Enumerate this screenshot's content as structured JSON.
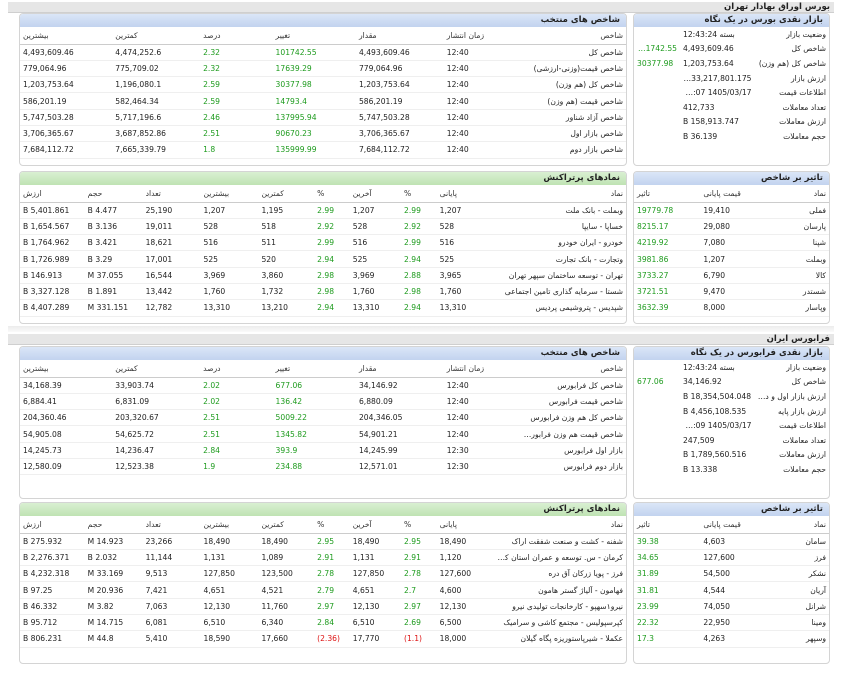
{
  "tehran": {
    "title": "بورس اوراق بهادار تهران",
    "market": {
      "header": "بازار نقدی بورس در یک نگاه",
      "rows": [
        {
          "k": "وضعیت بازار",
          "v": "بسته 12:43:24",
          "c": ""
        },
        {
          "k": "شاخص کل",
          "v": "4,493,609.46",
          "c": "101742.55"
        },
        {
          "k": "شاخص کل (هم وزن)",
          "v": "1,203,753.64",
          "c": "30377.98"
        },
        {
          "k": "ارزش بازار",
          "v": "133,217,801.175 B",
          "c": ""
        },
        {
          "k": "اطلاعات قیمت",
          "v": "1405/03/17 12:43:07",
          "c": ""
        },
        {
          "k": "تعداد معاملات",
          "v": "412,733",
          "c": ""
        },
        {
          "k": "ارزش معاملات",
          "v": "158,913.747 B",
          "c": ""
        },
        {
          "k": "حجم معاملات",
          "v": "36.139 B",
          "c": ""
        }
      ]
    },
    "indices": {
      "header": "شاخص های منتخب",
      "cols": [
        "شاخص",
        "زمان انتشار",
        "مقدار",
        "تغییر",
        "درصد",
        "کمترین",
        "بیشترین"
      ],
      "rows": [
        [
          "شاخص کل",
          "12:40",
          "4,493,609.46",
          "101742.55",
          "2.32",
          "4,474,252.6",
          "4,493,609.46"
        ],
        [
          "شاخص قیمت(وزنی-ارزشی)",
          "12:40",
          "779,064.96",
          "17639.29",
          "2.32",
          "775,709.02",
          "779,064.96"
        ],
        [
          "شاخص کل (هم وزن)",
          "12:40",
          "1,203,753.64",
          "30377.98",
          "2.59",
          "1,196,080.1",
          "1,203,753.64"
        ],
        [
          "شاخص قیمت (هم وزن)",
          "12:40",
          "586,201.19",
          "14793.4",
          "2.59",
          "582,464.34",
          "586,201.19"
        ],
        [
          "شاخص آزاد شناور",
          "12:40",
          "5,747,503.28",
          "137995.94",
          "2.46",
          "5,717,196.6",
          "5,747,503.28"
        ],
        [
          "شاخص بازار اول",
          "12:40",
          "3,706,365.67",
          "90670.23",
          "2.51",
          "3,687,852.86",
          "3,706,365.67"
        ],
        [
          "شاخص بازار دوم",
          "12:40",
          "7,684,112.72",
          "135999.99",
          "1.8",
          "7,665,339.79",
          "7,684,112.72"
        ]
      ]
    },
    "impact": {
      "header": "تاثیر بر شاخص",
      "cols": [
        "نماد",
        "قیمت پایانی",
        "تاثیر"
      ],
      "rows": [
        [
          "فملی",
          "19,410",
          "19779.78"
        ],
        [
          "پارسان",
          "29,080",
          "8215.17"
        ],
        [
          "شپنا",
          "7,080",
          "4219.92"
        ],
        [
          "وبملت",
          "1,207",
          "3981.86"
        ],
        [
          "کالا",
          "6,790",
          "3733.27"
        ],
        [
          "شستدر",
          "9,470",
          "3721.51"
        ],
        [
          "وپاسار",
          "8,000",
          "3632.39"
        ]
      ]
    },
    "symbols": {
      "header": "نمادهای پرتراکنش",
      "cols": [
        "نماد",
        "پایانی",
        "%",
        "آخرین",
        "%",
        "کمترین",
        "بیشترین",
        "تعداد",
        "حجم",
        "ارزش"
      ],
      "rows": [
        [
          "وبملت - بانک ملت",
          "1,207",
          "2.99",
          "1,207",
          "2.99",
          "1,195",
          "1,207",
          "25,190",
          "4.477 B",
          "5,401.861 B"
        ],
        [
          "خساپا - سایپا",
          "528",
          "2.92",
          "528",
          "2.92",
          "518",
          "528",
          "19,011",
          "3.136 B",
          "1,654.567 B"
        ],
        [
          "خودرو - ایران خودرو",
          "516",
          "2.99",
          "516",
          "2.99",
          "511",
          "516",
          "18,621",
          "3.421 B",
          "1,764.962 B"
        ],
        [
          "وتجارت - بانک تجارت",
          "525",
          "2.94",
          "525",
          "2.94",
          "520",
          "525",
          "17,001",
          "3.29 B",
          "1,726.989 B"
        ],
        [
          "تهران - توسعه ساختمان سپهر تهران",
          "3,965",
          "2.88",
          "3,969",
          "2.98",
          "3,860",
          "3,969",
          "16,544",
          "37.055 M",
          "146.913 B"
        ],
        [
          "شستا - سرمایه گذاری تامین اجتماعی",
          "1,760",
          "2.98",
          "1,760",
          "2.98",
          "1,732",
          "1,760",
          "13,442",
          "1.891 B",
          "3,327.128 B"
        ],
        [
          "شپدیس - پتروشیمی پردیس",
          "13,310",
          "2.94",
          "13,310",
          "2.94",
          "13,210",
          "13,310",
          "12,782",
          "331.151 M",
          "4,407.289 B"
        ]
      ]
    }
  },
  "farabourse": {
    "title": "فرابورس ایران",
    "market": {
      "header": "بازار نقدی فرابورس در یک نگاه",
      "rows": [
        {
          "k": "وضعیت بازار",
          "v": "بسته 12:43:24",
          "c": ""
        },
        {
          "k": "شاخص کل",
          "v": "34,146.92",
          "c": "677.06"
        },
        {
          "k": "ارزش بازار اول و دوم",
          "v": "18,354,504.048 B",
          "c": ""
        },
        {
          "k": "ارزش بازار پایه",
          "v": "4,456,108.535 B",
          "c": ""
        },
        {
          "k": "اطلاعات قیمت",
          "v": "1405/03/17 12:43:09",
          "c": ""
        },
        {
          "k": "تعداد معاملات",
          "v": "247,509",
          "c": ""
        },
        {
          "k": "ارزش معاملات",
          "v": "1,789,560.516 B",
          "c": ""
        },
        {
          "k": "حجم معاملات",
          "v": "13.338 B",
          "c": ""
        }
      ]
    },
    "indices": {
      "header": "شاخص های منتخب",
      "cols": [
        "شاخص",
        "زمان انتشار",
        "مقدار",
        "تغییر",
        "درصد",
        "کمترین",
        "بیشترین"
      ],
      "rows": [
        [
          "شاخص کل فرابورس",
          "12:40",
          "34,146.92",
          "677.06",
          "2.02",
          "33,903.74",
          "34,168.39"
        ],
        [
          "شاخص قیمت فرابورس",
          "12:40",
          "6,880.09",
          "136.42",
          "2.02",
          "6,831.09",
          "6,884.41"
        ],
        [
          "شاخص کل هم وزن فرابورس",
          "12:40",
          "204,346.05",
          "5009.22",
          "2.51",
          "203,320.67",
          "204,360.46"
        ],
        [
          "شاخص قیمت هم وزن فرابورس",
          "12:40",
          "54,901.21",
          "1345.82",
          "2.51",
          "54,625.72",
          "54,905.08"
        ],
        [
          "بازار اول فرابورس",
          "12:30",
          "14,245.99",
          "393.9",
          "2.84",
          "14,236.47",
          "14,245.73"
        ],
        [
          "بازار دوم فرابورس",
          "12:30",
          "12,571.01",
          "234.88",
          "1.9",
          "12,523.38",
          "12,580.09"
        ]
      ]
    },
    "impact": {
      "header": "تاثیر بر شاخص",
      "cols": [
        "نماد",
        "قیمت پایانی",
        "تاثیر"
      ],
      "rows": [
        [
          "سامان",
          "4,603",
          "39.38"
        ],
        [
          "فرز",
          "127,600",
          "34.65"
        ],
        [
          "نشکر",
          "54,500",
          "31.89"
        ],
        [
          "آریان",
          "4,544",
          "31.81"
        ],
        [
          "شرانل",
          "74,050",
          "23.99"
        ],
        [
          "ومینا",
          "22,950",
          "22.32"
        ],
        [
          "وسپهر",
          "4,263",
          "17.3"
        ]
      ]
    },
    "symbols": {
      "header": "نمادهای پرتراکنش",
      "cols": [
        "نماد",
        "پایانی",
        "%",
        "آخرین",
        "%",
        "کمترین",
        "بیشترین",
        "تعداد",
        "حجم",
        "ارزش"
      ],
      "rows": [
        [
          "شفنه - کشت و صنعت شفقت اراک",
          "18,490",
          "2.95",
          "18,490",
          "2.95",
          "18,490",
          "18,490",
          "23,266",
          "14.923 M",
          "275.932 B"
        ],
        [
          "کرمان - س. توسعه و عمران استان کرمان",
          "1,120",
          "2.91",
          "1,131",
          "2.91",
          "1,089",
          "1,131",
          "11,144",
          "2.032 B",
          "2,276.371 B"
        ],
        [
          "فرز - پویا زرکان آق دره",
          "127,600",
          "2.78",
          "127,850",
          "2.78",
          "123,500",
          "127,850",
          "9,513",
          "33.169 M",
          "4,232.318 B"
        ],
        [
          "فهامون - آلیاژ گستر هامون",
          "4,600",
          "2.7",
          "4,651",
          "2.79",
          "4,521",
          "4,651",
          "7,421",
          "20.936 M",
          "97.25 B"
        ],
        [
          "نیرو۱سهپو - کارخانجات تولیدی نیرو",
          "12,130",
          "2.97",
          "12,130",
          "2.97",
          "11,760",
          "12,130",
          "7,063",
          "3.82 M",
          "46.332 B"
        ],
        [
          "کپرسپولیس - مجتمع کاشی و سرامیک",
          "6,500",
          "2.69",
          "6,510",
          "2.84",
          "6,340",
          "6,510",
          "6,081",
          "14.715 M",
          "95.712 B"
        ],
        [
          "عکملا - شیرپاستوریزه پگاه گیلان",
          "18,000",
          "(1.1)",
          "17,770",
          "(2.36)",
          "17,660",
          "18,590",
          "5,410",
          "44.8 M",
          "806.231 B"
        ]
      ]
    }
  }
}
